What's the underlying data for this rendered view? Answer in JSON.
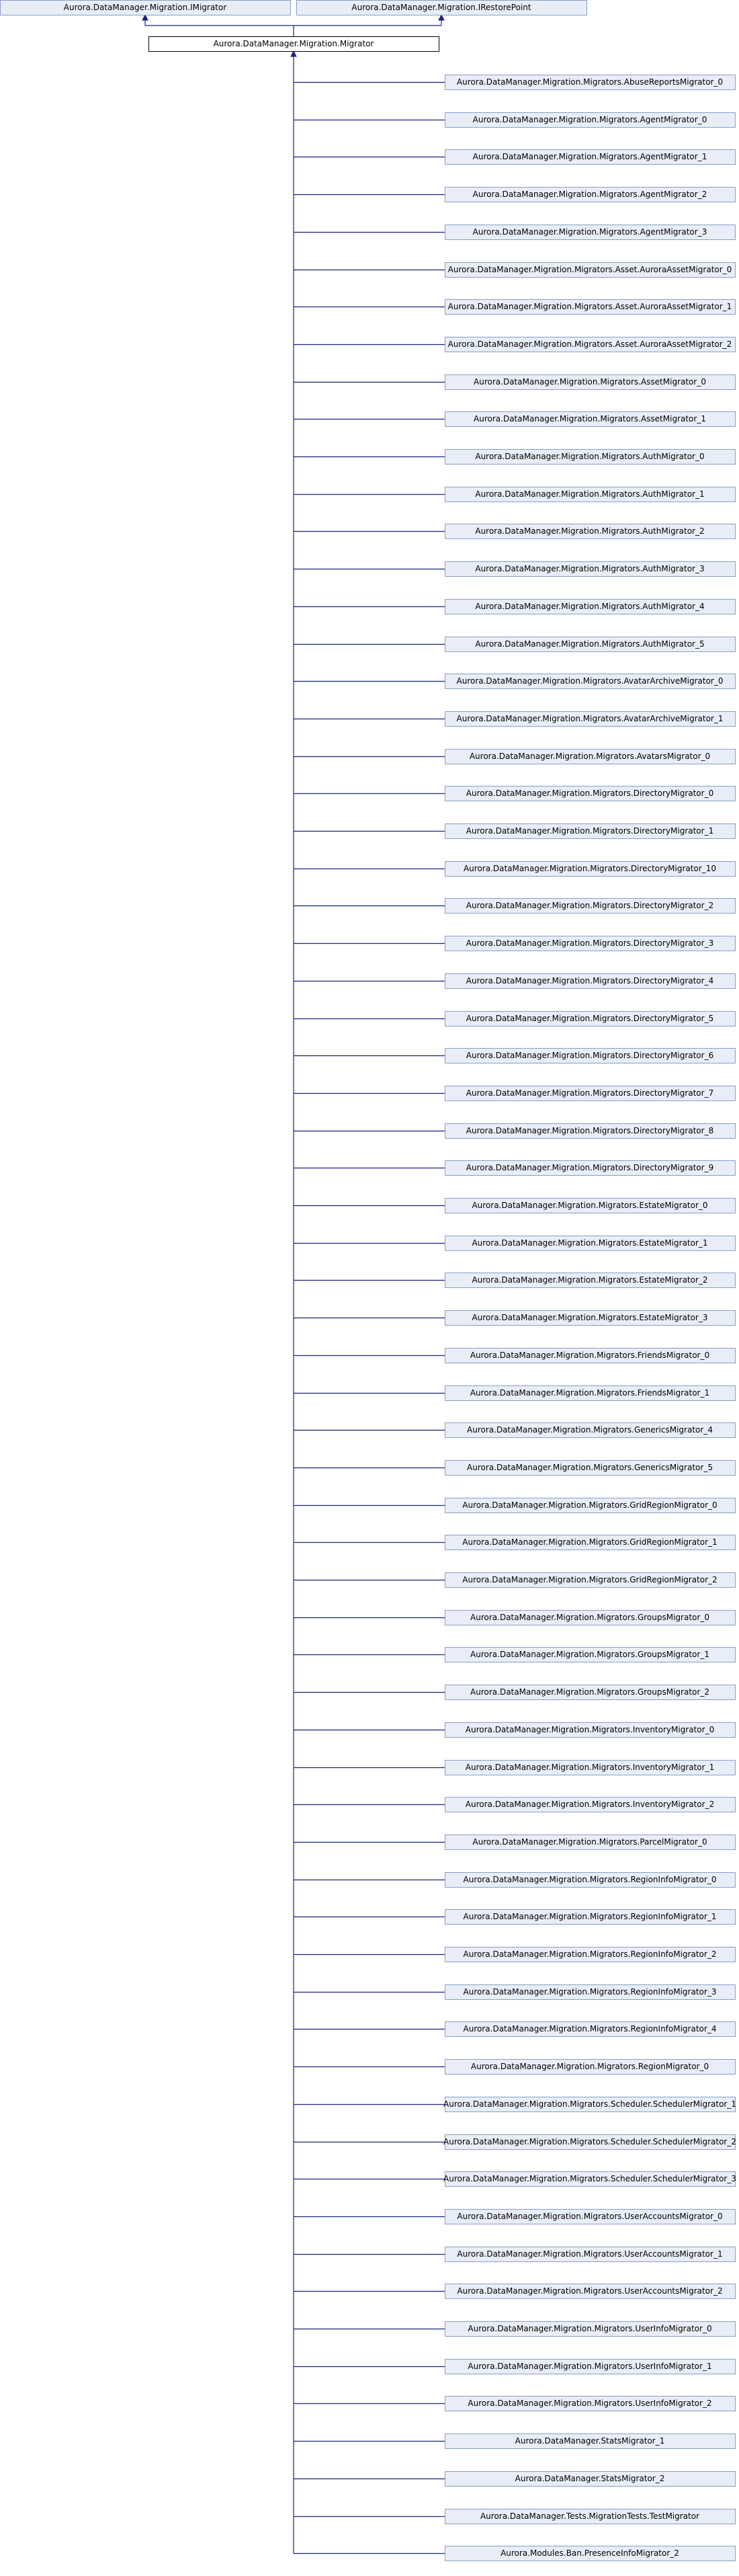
{
  "colors": {
    "node_fill": "#e8edf7",
    "node_stroke": "#8a9ec9",
    "focus_fill": "#ffffff",
    "focus_stroke": "#000000",
    "edge": "#1a237e"
  },
  "interfaces": [
    "Aurora.DataManager.Migration.IMigrator",
    "Aurora.DataManager.Migration.IRestorePoint"
  ],
  "base": "Aurora.DataManager.Migration.Migrator",
  "derived": [
    "Aurora.DataManager.Migration.Migrators.AbuseReportsMigrator_0",
    "Aurora.DataManager.Migration.Migrators.AgentMigrator_0",
    "Aurora.DataManager.Migration.Migrators.AgentMigrator_1",
    "Aurora.DataManager.Migration.Migrators.AgentMigrator_2",
    "Aurora.DataManager.Migration.Migrators.AgentMigrator_3",
    "Aurora.DataManager.Migration.Migrators.Asset.AuroraAssetMigrator_0",
    "Aurora.DataManager.Migration.Migrators.Asset.AuroraAssetMigrator_1",
    "Aurora.DataManager.Migration.Migrators.Asset.AuroraAssetMigrator_2",
    "Aurora.DataManager.Migration.Migrators.AssetMigrator_0",
    "Aurora.DataManager.Migration.Migrators.AssetMigrator_1",
    "Aurora.DataManager.Migration.Migrators.AuthMigrator_0",
    "Aurora.DataManager.Migration.Migrators.AuthMigrator_1",
    "Aurora.DataManager.Migration.Migrators.AuthMigrator_2",
    "Aurora.DataManager.Migration.Migrators.AuthMigrator_3",
    "Aurora.DataManager.Migration.Migrators.AuthMigrator_4",
    "Aurora.DataManager.Migration.Migrators.AuthMigrator_5",
    "Aurora.DataManager.Migration.Migrators.AvatarArchiveMigrator_0",
    "Aurora.DataManager.Migration.Migrators.AvatarArchiveMigrator_1",
    "Aurora.DataManager.Migration.Migrators.AvatarsMigrator_0",
    "Aurora.DataManager.Migration.Migrators.DirectoryMigrator_0",
    "Aurora.DataManager.Migration.Migrators.DirectoryMigrator_1",
    "Aurora.DataManager.Migration.Migrators.DirectoryMigrator_10",
    "Aurora.DataManager.Migration.Migrators.DirectoryMigrator_2",
    "Aurora.DataManager.Migration.Migrators.DirectoryMigrator_3",
    "Aurora.DataManager.Migration.Migrators.DirectoryMigrator_4",
    "Aurora.DataManager.Migration.Migrators.DirectoryMigrator_5",
    "Aurora.DataManager.Migration.Migrators.DirectoryMigrator_6",
    "Aurora.DataManager.Migration.Migrators.DirectoryMigrator_7",
    "Aurora.DataManager.Migration.Migrators.DirectoryMigrator_8",
    "Aurora.DataManager.Migration.Migrators.DirectoryMigrator_9",
    "Aurora.DataManager.Migration.Migrators.EstateMigrator_0",
    "Aurora.DataManager.Migration.Migrators.EstateMigrator_1",
    "Aurora.DataManager.Migration.Migrators.EstateMigrator_2",
    "Aurora.DataManager.Migration.Migrators.EstateMigrator_3",
    "Aurora.DataManager.Migration.Migrators.FriendsMigrator_0",
    "Aurora.DataManager.Migration.Migrators.FriendsMigrator_1",
    "Aurora.DataManager.Migration.Migrators.GenericsMigrator_4",
    "Aurora.DataManager.Migration.Migrators.GenericsMigrator_5",
    "Aurora.DataManager.Migration.Migrators.GridRegionMigrator_0",
    "Aurora.DataManager.Migration.Migrators.GridRegionMigrator_1",
    "Aurora.DataManager.Migration.Migrators.GridRegionMigrator_2",
    "Aurora.DataManager.Migration.Migrators.GroupsMigrator_0",
    "Aurora.DataManager.Migration.Migrators.GroupsMigrator_1",
    "Aurora.DataManager.Migration.Migrators.GroupsMigrator_2",
    "Aurora.DataManager.Migration.Migrators.InventoryMigrator_0",
    "Aurora.DataManager.Migration.Migrators.InventoryMigrator_1",
    "Aurora.DataManager.Migration.Migrators.InventoryMigrator_2",
    "Aurora.DataManager.Migration.Migrators.ParcelMigrator_0",
    "Aurora.DataManager.Migration.Migrators.RegionInfoMigrator_0",
    "Aurora.DataManager.Migration.Migrators.RegionInfoMigrator_1",
    "Aurora.DataManager.Migration.Migrators.RegionInfoMigrator_2",
    "Aurora.DataManager.Migration.Migrators.RegionInfoMigrator_3",
    "Aurora.DataManager.Migration.Migrators.RegionInfoMigrator_4",
    "Aurora.DataManager.Migration.Migrators.RegionMigrator_0",
    "Aurora.DataManager.Migration.Migrators.Scheduler.SchedulerMigrator_1",
    "Aurora.DataManager.Migration.Migrators.Scheduler.SchedulerMigrator_2",
    "Aurora.DataManager.Migration.Migrators.Scheduler.SchedulerMigrator_3",
    "Aurora.DataManager.Migration.Migrators.UserAccountsMigrator_0",
    "Aurora.DataManager.Migration.Migrators.UserAccountsMigrator_1",
    "Aurora.DataManager.Migration.Migrators.UserAccountsMigrator_2",
    "Aurora.DataManager.Migration.Migrators.UserInfoMigrator_0",
    "Aurora.DataManager.Migration.Migrators.UserInfoMigrator_1",
    "Aurora.DataManager.Migration.Migrators.UserInfoMigrator_2",
    "Aurora.DataManager.StatsMigrator_1",
    "Aurora.DataManager.StatsMigrator_2",
    "Aurora.DataManager.Tests.MigrationTests.TestMigrator",
    "Aurora.Modules.Ban.PresenceInfoMigrator_2"
  ]
}
